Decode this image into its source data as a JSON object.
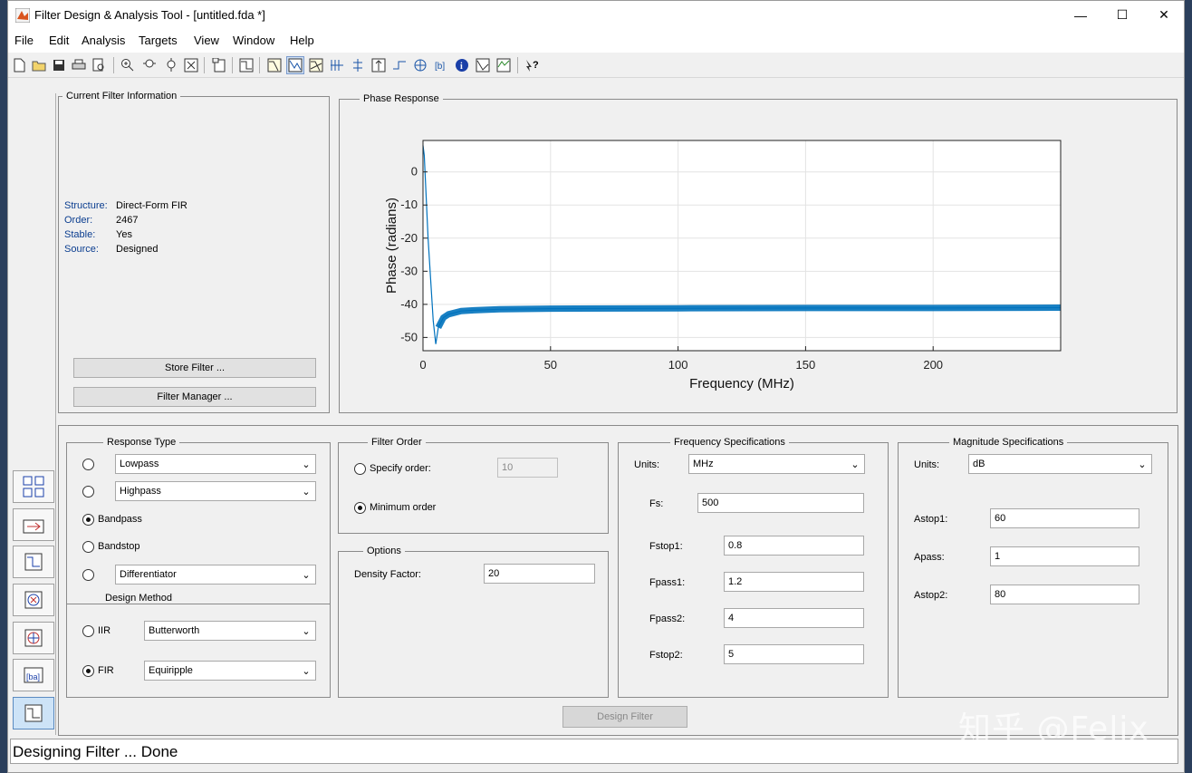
{
  "window": {
    "title": "Filter Design & Analysis Tool -  [untitled.fda *]",
    "controls": {
      "minimize": "—",
      "maximize": "☐",
      "close": "✕"
    }
  },
  "menu": [
    "File",
    "Edit",
    "Analysis",
    "Targets",
    "View",
    "Window",
    "Help"
  ],
  "toolbar_icons": [
    "new-file",
    "open-folder",
    "save",
    "print",
    "print-preview",
    "zoom-in",
    "zoom-x",
    "zoom-y",
    "full-view",
    "new-figure",
    "filter-specifications",
    "magnitude-response",
    "phase-response",
    "magnitude-phase",
    "group-delay",
    "phase-delay",
    "impulse-response",
    "step-response",
    "pole-zero",
    "filter-coefficients",
    "filter-information",
    "magnitude-estimate",
    "round-off-noise",
    "whats-this"
  ],
  "current_filter_info": {
    "legend": "Current Filter Information",
    "fields": [
      {
        "key": "Structure:",
        "value": "Direct-Form FIR"
      },
      {
        "key": "Order:",
        "value": "2467"
      },
      {
        "key": "Stable:",
        "value": "Yes"
      },
      {
        "key": "Source:",
        "value": "Designed"
      }
    ],
    "store_button": "Store Filter ...",
    "manager_button": "Filter Manager ..."
  },
  "phase_panel": {
    "legend": "Phase Response"
  },
  "chart_data": {
    "type": "line",
    "xlabel": "Frequency (MHz)",
    "ylabel": "Phase (radians)",
    "xlim": [
      0,
      250
    ],
    "ylim": [
      -54,
      9.5
    ],
    "xticks": [
      0,
      50,
      100,
      150,
      200
    ],
    "yticks": [
      0,
      -10,
      -20,
      -30,
      -40,
      -50
    ],
    "grid": true,
    "line_color": "#0072bd",
    "series": [
      {
        "x": [
          0,
          0.5,
          2,
          4,
          5,
          6,
          8,
          10,
          15,
          20,
          30,
          50,
          100,
          150,
          200,
          250
        ],
        "y": [
          8,
          5,
          -20,
          -45,
          -52,
          -47,
          -44,
          -43,
          -42,
          -41.8,
          -41.5,
          -41.3,
          -41.2,
          -41.1,
          -41.1,
          -41
        ]
      }
    ]
  },
  "response_type": {
    "legend": "Response Type",
    "options": [
      {
        "label": "Lowpass",
        "selected": false,
        "dropdown": true
      },
      {
        "label": "Highpass",
        "selected": false,
        "dropdown": true
      },
      {
        "label": "Bandpass",
        "selected": true,
        "dropdown": false
      },
      {
        "label": "Bandstop",
        "selected": false,
        "dropdown": false
      },
      {
        "label": "Differentiator",
        "selected": false,
        "dropdown": true
      }
    ]
  },
  "design_method": {
    "legend": "Design Method",
    "iir_label": "IIR",
    "iir_value": "Butterworth",
    "fir_label": "FIR",
    "fir_value": "Equiripple",
    "selected": "FIR"
  },
  "filter_order": {
    "legend": "Filter Order",
    "specify_label": "Specify order:",
    "specify_value": "10",
    "minimum_label": "Minimum order",
    "selected": "minimum"
  },
  "options": {
    "legend": "Options",
    "density_label": "Density Factor:",
    "density_value": "20"
  },
  "frequency_specs": {
    "legend": "Frequency Specifications",
    "units_label": "Units:",
    "units_value": "MHz",
    "fs_label": "Fs:",
    "fs_value": "500",
    "fields": [
      {
        "label": "Fstop1:",
        "value": "0.8"
      },
      {
        "label": "Fpass1:",
        "value": "1.2"
      },
      {
        "label": "Fpass2:",
        "value": "4"
      },
      {
        "label": "Fstop2:",
        "value": "5"
      }
    ]
  },
  "magnitude_specs": {
    "legend": "Magnitude Specifications",
    "units_label": "Units:",
    "units_value": "dB",
    "fields": [
      {
        "label": "Astop1:",
        "value": "60"
      },
      {
        "label": "Apass:",
        "value": "1"
      },
      {
        "label": "Astop2:",
        "value": "80"
      }
    ]
  },
  "design_button": "Design Filter",
  "status": "Designing Filter ... Done",
  "watermark": "知乎 @Felix"
}
